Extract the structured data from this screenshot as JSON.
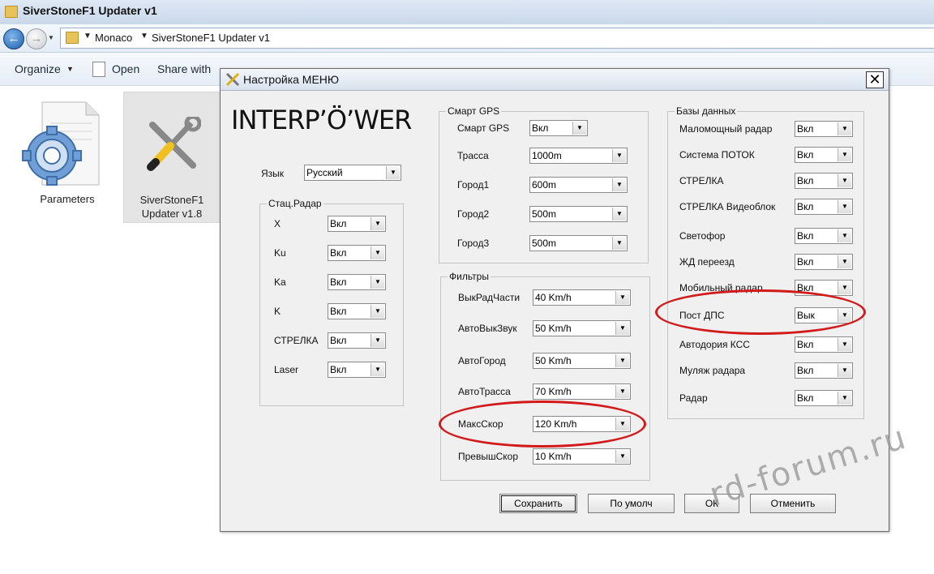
{
  "window": {
    "title": "SiverStoneF1 Updater v1"
  },
  "address": {
    "crumbs": [
      "Monaco",
      "SiverStoneF1 Updater v1"
    ]
  },
  "toolbar": {
    "organize": "Organize",
    "open": "Open",
    "share": "Share with"
  },
  "files": [
    {
      "label": "Parameters",
      "icon": "gear-document-icon"
    },
    {
      "label_line1": "SiverStoneF1",
      "label_line2": "Updater v1.8",
      "icon": "tools-icon"
    }
  ],
  "dialog": {
    "title": "Настройка МЕНЮ",
    "logo": "INTERP’Ö’WER",
    "language": {
      "label": "Язык",
      "value": "Русский"
    },
    "stat_radar": {
      "title": "Стац.Радар",
      "rows": [
        {
          "label": "X",
          "value": "Вкл"
        },
        {
          "label": "Ku",
          "value": "Вкл"
        },
        {
          "label": "Ka",
          "value": "Вкл"
        },
        {
          "label": "K",
          "value": "Вкл"
        },
        {
          "label": "СТРЕЛКА",
          "value": "Вкл"
        },
        {
          "label": "Laser",
          "value": "Вкл"
        }
      ]
    },
    "smart_gps": {
      "title": "Смарт GPS",
      "rows": [
        {
          "label": "Смарт GPS",
          "value": "Вкл"
        },
        {
          "label": "Трасса",
          "value": "1000m"
        },
        {
          "label": "Город1",
          "value": "600m"
        },
        {
          "label": "Город2",
          "value": "500m"
        },
        {
          "label": "Город3",
          "value": "500m"
        }
      ]
    },
    "filters": {
      "title": "Фильтры",
      "rows": [
        {
          "label": "ВыкРадЧасти",
          "value": "40 Km/h"
        },
        {
          "label": "АвтоВыкЗвук",
          "value": "50 Km/h"
        },
        {
          "label": "АвтоГород",
          "value": "50 Km/h"
        },
        {
          "label": "АвтоТрасса",
          "value": "70 Km/h"
        },
        {
          "label": "МаксСкор",
          "value": "120 Km/h"
        },
        {
          "label": "ПревышСкор",
          "value": "10 Km/h"
        }
      ]
    },
    "databases": {
      "title": "Базы данных",
      "rows": [
        {
          "label": "Маломощный радар",
          "value": "Вкл"
        },
        {
          "label": "Система ПОТОК",
          "value": "Вкл"
        },
        {
          "label": "СТРЕЛКА",
          "value": "Вкл"
        },
        {
          "label": "СТРЕЛКА Видеоблок",
          "value": "Вкл"
        },
        {
          "label": "Светофор",
          "value": "Вкл"
        },
        {
          "label": "ЖД переезд",
          "value": "Вкл"
        },
        {
          "label": "Мобильный радар",
          "value": "Вкл"
        },
        {
          "label": "Пост ДПС",
          "value": "Вык"
        },
        {
          "label": "Автодория КСС",
          "value": "Вкл"
        },
        {
          "label": "Муляж радара",
          "value": "Вкл"
        },
        {
          "label": "Радар",
          "value": "Вкл"
        }
      ]
    },
    "buttons": {
      "save": "Сохранить",
      "default": "По умолч",
      "ok": "ОК",
      "cancel": "Отменить"
    }
  },
  "watermark": "rd-forum.ru",
  "colors": {
    "highlight": "#d21a1a",
    "dialog_bg": "#f0f0f0"
  }
}
